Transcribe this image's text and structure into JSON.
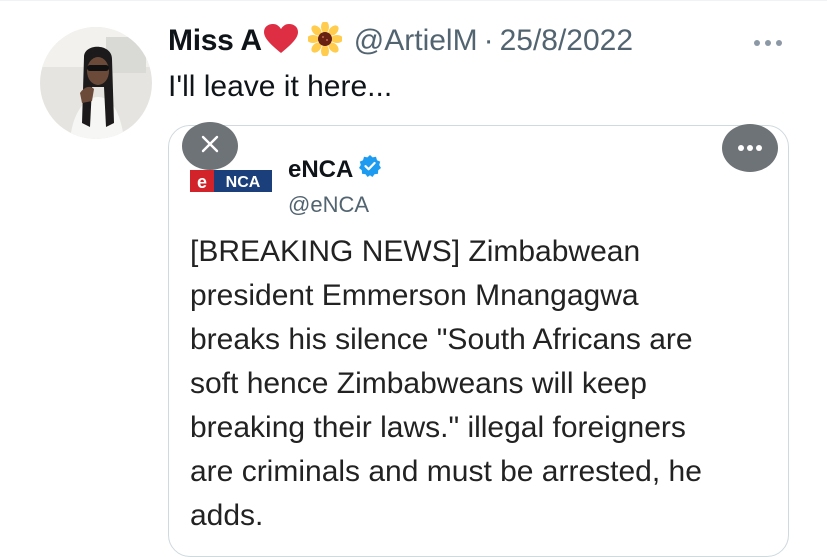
{
  "tweet": {
    "display_name": "Miss A",
    "heart_emoji": "red-heart",
    "sunflower_emoji": "sunflower",
    "handle": "@ArtielM",
    "separator": "·",
    "timestamp": "25/8/2022",
    "more_icon": "more-horizontal-icon",
    "text": "I'll leave it here..."
  },
  "embedded": {
    "close_icon": "close-icon",
    "more_icon": "more-horizontal-icon",
    "logo_text": "eNCA",
    "display_name": "eNCA",
    "verified_icon": "verified-badge-icon",
    "handle": "@eNCA",
    "text_lines": [
      "[BREAKING NEWS] Zimbabwean",
      "president Emmerson Mnangagwa",
      "breaks his silence \"South Africans are",
      "soft hence Zimbabweans will keep",
      "breaking their laws.\" illegal foreigners",
      "are criminals and must be arrested, he",
      "adds."
    ]
  },
  "colors": {
    "name_text": "#0f1419",
    "secondary_text": "#536471",
    "verified_blue": "#1d9bf0",
    "enca_red": "#d2232a",
    "overlay_button": "#6e7377",
    "border": "#cfd9de"
  }
}
